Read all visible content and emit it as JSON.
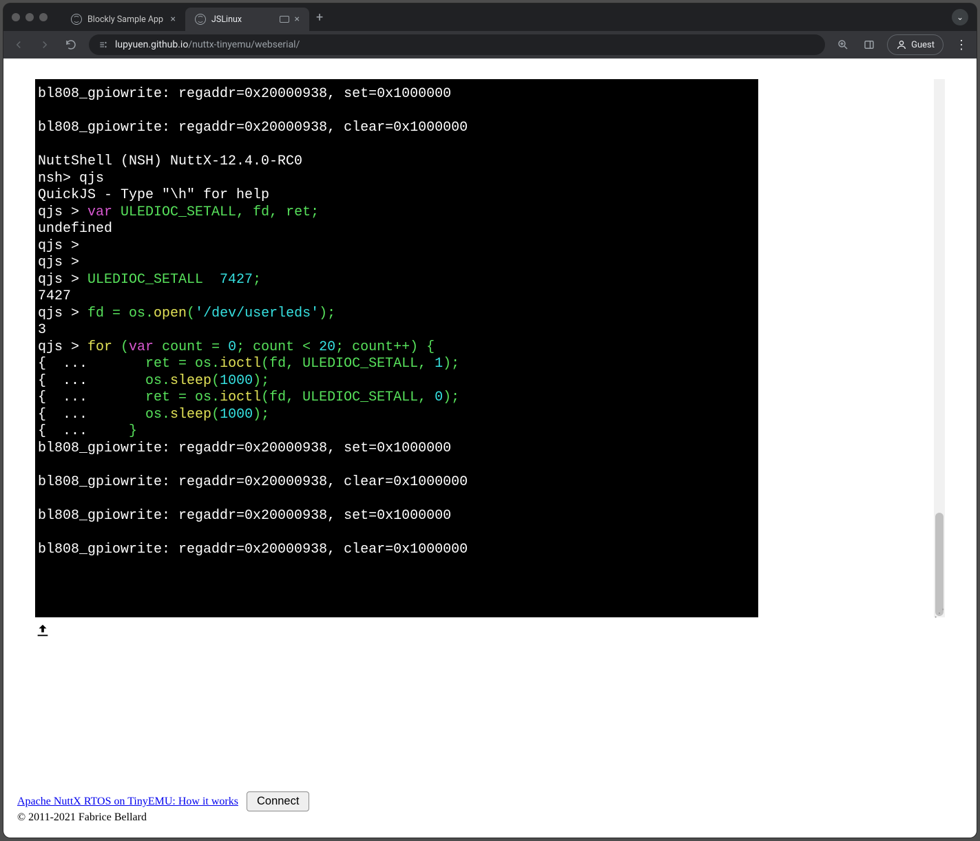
{
  "browser": {
    "tabs": [
      {
        "title": "Blockly Sample App",
        "active": false
      },
      {
        "title": "JSLinux",
        "active": true
      }
    ],
    "new_tab_glyph": "+",
    "dropdown_glyph": "⌄",
    "nav": {
      "back_label": "Back",
      "forward_label": "Forward",
      "reload_label": "Reload"
    },
    "url_host": "lupyuen.github.io",
    "url_path": "/nuttx-tinyemu/webserial/",
    "zoom_icon": "zoom",
    "panel_icon": "panel",
    "guest_label": "Guest",
    "menu_glyph": "⋮"
  },
  "terminal": {
    "lines": [
      [
        {
          "t": "bl808_gpiowrite: regaddr=0x20000938, set=0x1000000"
        }
      ],
      [
        {
          "t": ""
        }
      ],
      [
        {
          "t": "bl808_gpiowrite: regaddr=0x20000938, clear=0x1000000"
        }
      ],
      [
        {
          "t": ""
        }
      ],
      [
        {
          "t": "NuttShell (NSH) NuttX-12.4.0-RC0"
        }
      ],
      [
        {
          "t": "nsh> qjs"
        }
      ],
      [
        {
          "t": "QuickJS - Type \"\\h\" for help"
        }
      ],
      [
        {
          "t": "qjs > "
        },
        {
          "t": "var ",
          "c": "mag"
        },
        {
          "t": "ULEDIOC_SETALL, fd, ret;",
          "c": "grn"
        }
      ],
      [
        {
          "t": "undefined"
        }
      ],
      [
        {
          "t": "qjs > "
        }
      ],
      [
        {
          "t": "qjs > "
        }
      ],
      [
        {
          "t": "qjs > "
        },
        {
          "t": "ULEDIOC_SETALL  ",
          "c": "grn"
        },
        {
          "t": "7427",
          "c": "cyn"
        },
        {
          "t": ";",
          "c": "grn"
        }
      ],
      [
        {
          "t": "7427"
        }
      ],
      [
        {
          "t": "qjs > "
        },
        {
          "t": "fd = os.",
          "c": "grn"
        },
        {
          "t": "open",
          "c": "ylw"
        },
        {
          "t": "(",
          "c": "grn"
        },
        {
          "t": "'/dev/userleds'",
          "c": "cyn"
        },
        {
          "t": ");",
          "c": "grn"
        }
      ],
      [
        {
          "t": "3"
        }
      ],
      [
        {
          "t": "qjs > "
        },
        {
          "t": "for ",
          "c": "ylw"
        },
        {
          "t": "(",
          "c": "grn"
        },
        {
          "t": "var ",
          "c": "mag"
        },
        {
          "t": "count = ",
          "c": "grn"
        },
        {
          "t": "0",
          "c": "cyn"
        },
        {
          "t": "; count < ",
          "c": "grn"
        },
        {
          "t": "20",
          "c": "cyn"
        },
        {
          "t": "; count++) {",
          "c": "grn"
        }
      ],
      [
        {
          "t": "{  ...       "
        },
        {
          "t": "ret = os.",
          "c": "grn"
        },
        {
          "t": "ioctl",
          "c": "ylw"
        },
        {
          "t": "(fd, ULEDIOC_SETALL, ",
          "c": "grn"
        },
        {
          "t": "1",
          "c": "cyn"
        },
        {
          "t": ");",
          "c": "grn"
        }
      ],
      [
        {
          "t": "{  ...       "
        },
        {
          "t": "os.",
          "c": "grn"
        },
        {
          "t": "sleep",
          "c": "ylw"
        },
        {
          "t": "(",
          "c": "grn"
        },
        {
          "t": "1000",
          "c": "cyn"
        },
        {
          "t": ");",
          "c": "grn"
        }
      ],
      [
        {
          "t": "{  ...       "
        },
        {
          "t": "ret = os.",
          "c": "grn"
        },
        {
          "t": "ioctl",
          "c": "ylw"
        },
        {
          "t": "(fd, ULEDIOC_SETALL, ",
          "c": "grn"
        },
        {
          "t": "0",
          "c": "cyn"
        },
        {
          "t": ");",
          "c": "grn"
        }
      ],
      [
        {
          "t": "{  ...       "
        },
        {
          "t": "os.",
          "c": "grn"
        },
        {
          "t": "sleep",
          "c": "ylw"
        },
        {
          "t": "(",
          "c": "grn"
        },
        {
          "t": "1000",
          "c": "cyn"
        },
        {
          "t": ");",
          "c": "grn"
        }
      ],
      [
        {
          "t": "{  ...     "
        },
        {
          "t": "}",
          "c": "grn"
        }
      ],
      [
        {
          "t": "bl808_gpiowrite: regaddr=0x20000938, set=0x1000000"
        }
      ],
      [
        {
          "t": ""
        }
      ],
      [
        {
          "t": "bl808_gpiowrite: regaddr=0x20000938, clear=0x1000000"
        }
      ],
      [
        {
          "t": ""
        }
      ],
      [
        {
          "t": "bl808_gpiowrite: regaddr=0x20000938, set=0x1000000"
        }
      ],
      [
        {
          "t": ""
        }
      ],
      [
        {
          "t": "bl808_gpiowrite: regaddr=0x20000938, clear=0x1000000"
        }
      ]
    ]
  },
  "footer": {
    "link_text": "Apache NuttX RTOS on TinyEMU: How it works",
    "connect_label": "Connect",
    "copyright": "© 2011-2021 Fabrice Bellard"
  }
}
